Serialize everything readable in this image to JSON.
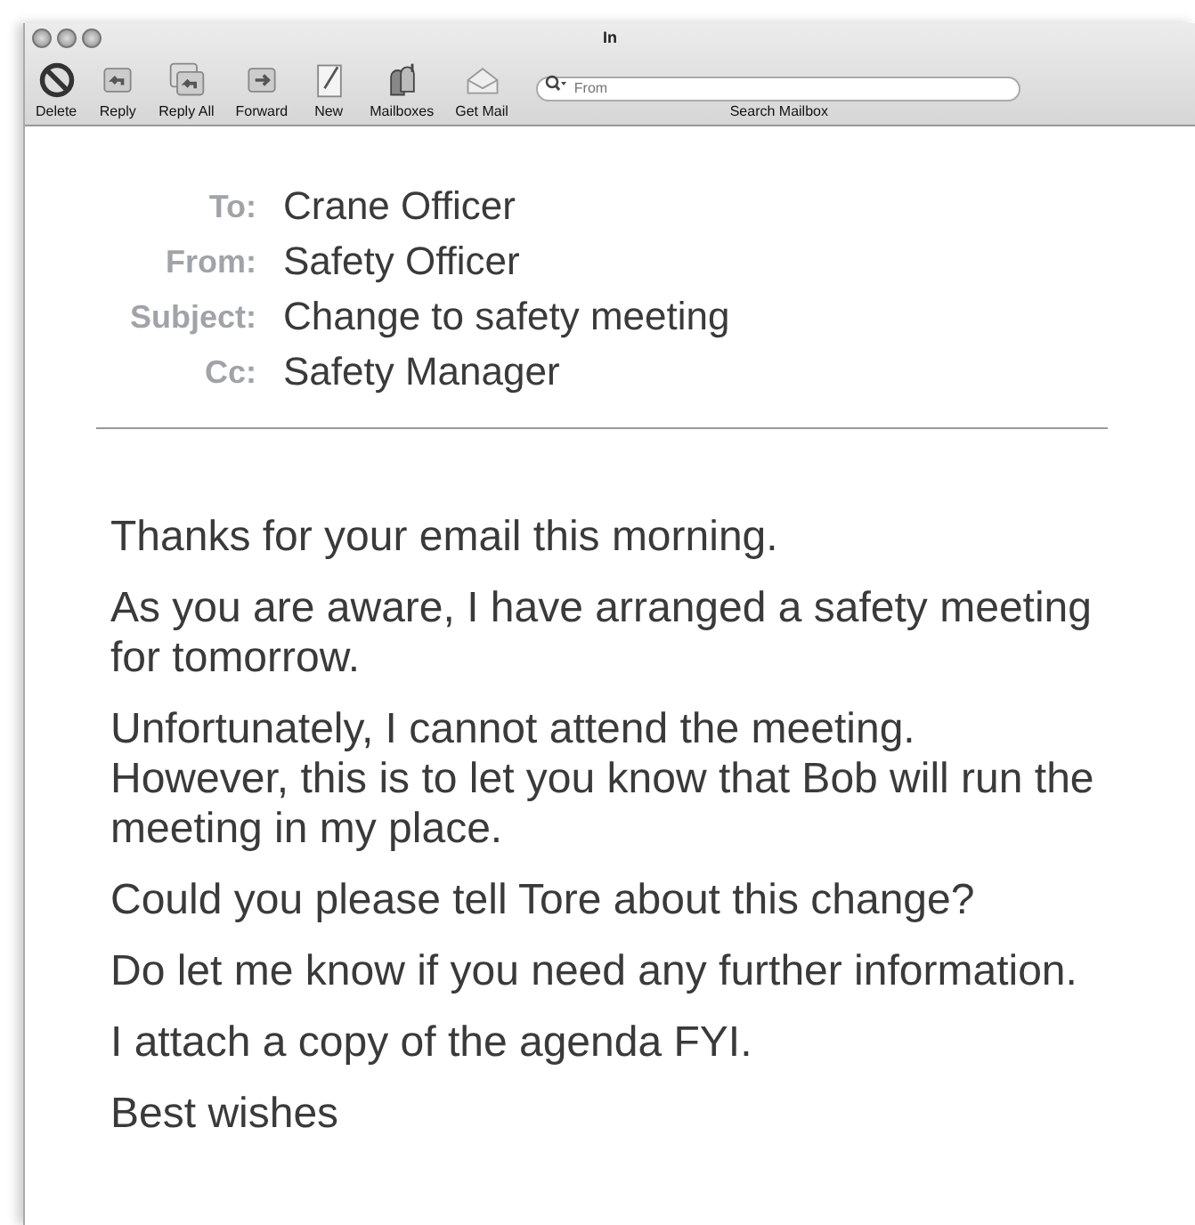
{
  "window": {
    "title": "In"
  },
  "toolbar": [
    {
      "kind": "delete",
      "label": "Delete"
    },
    {
      "kind": "reply",
      "label": "Reply"
    },
    {
      "kind": "reply-all",
      "label": "Reply All"
    },
    {
      "kind": "forward",
      "label": "Forward"
    },
    {
      "kind": "new",
      "label": "New"
    },
    {
      "kind": "mailboxes",
      "label": "Mailboxes"
    },
    {
      "kind": "get-mail",
      "label": "Get Mail"
    }
  ],
  "search": {
    "placeholder": "From",
    "label": "Search Mailbox"
  },
  "headers": [
    {
      "label": "To:",
      "value": "Crane Officer"
    },
    {
      "label": "From:",
      "value": "Safety Officer"
    },
    {
      "label": "Subject:",
      "value": "Change to safety meeting"
    },
    {
      "label": "Cc:",
      "value": "Safety Manager"
    }
  ],
  "body": [
    {
      "lines": [
        "Thanks for your email this morning."
      ]
    },
    {
      "lines": [
        "As you are aware, I have arranged a safety meeting",
        "for tomorrow."
      ]
    },
    {
      "lines": [
        "Unfortunately, I cannot attend the meeting.",
        "However, this is to let you know that Bob will run the",
        "meeting in my place."
      ]
    },
    {
      "lines": [
        "Could you please tell Tore about this change?"
      ]
    },
    {
      "lines": [
        "Do let me know if you need any further information."
      ]
    },
    {
      "lines": [
        "I attach a copy of the agenda FYI."
      ]
    },
    {
      "lines": [
        "Best wishes"
      ]
    }
  ]
}
